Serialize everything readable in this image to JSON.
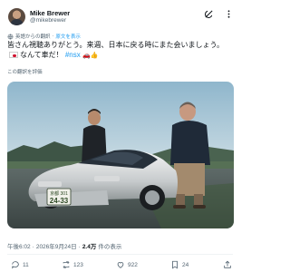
{
  "author": {
    "name": "Mike Brewer",
    "handle": "@mikebrewer"
  },
  "translation": {
    "source": "英語からの翻訳",
    "link": "原文を表示",
    "rate": "この翻訳を評価"
  },
  "tweet": {
    "text": "皆さん視聴ありがとう。来週、日本に戻る時にまた会いましょう。",
    "text_after_flag": "なんて車だ！",
    "hashtag": "#nsx",
    "emojis": [
      "🚗",
      "👍"
    ]
  },
  "photo": {
    "plate_top": "京都 301",
    "plate_number": "24-33"
  },
  "meta": {
    "time": "午後6:02",
    "date": "2026年9月24日",
    "views": "2.4万",
    "views_label": "件の表示"
  },
  "actions": {
    "replies": "11",
    "reposts": "123",
    "likes": "922",
    "bookmarks": "24"
  },
  "colors": {
    "accent": "#1d9bf0",
    "text": "#0f1419",
    "muted": "#536471",
    "flag_red": "#d1132f"
  }
}
